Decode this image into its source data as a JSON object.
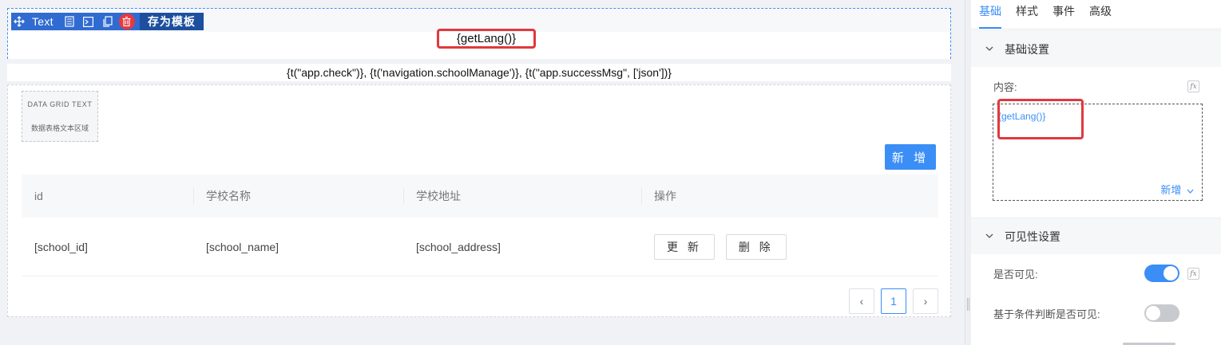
{
  "toolbar": {
    "component_label": "Text",
    "save_template_label": "存为模板",
    "icons": [
      "move-icon",
      "copy-icon",
      "code-icon",
      "duplicate-icon",
      "delete-icon"
    ]
  },
  "text_component": {
    "content": "{getLang()}"
  },
  "i18n_line": "{t(\"app.check\")},  {t('navigation.schoolManage')},  {t(\"app.successMsg\", ['json'])}",
  "data_grid": {
    "badge_title": "DATA GRID TEXT",
    "badge_subtitle": "数据表格文本区域",
    "add_label": "新 增",
    "columns": [
      "id",
      "学校名称",
      "学校地址",
      "操作"
    ],
    "row": {
      "id": "[school_id]",
      "name": "[school_name]",
      "address": "[school_address]",
      "update_label": "更 新",
      "delete_label": "删 除"
    },
    "pagination": {
      "prev": "‹",
      "current": "1",
      "next": "›"
    }
  },
  "panel": {
    "tabs": [
      "基础",
      "样式",
      "事件",
      "高级"
    ],
    "active_tab": "基础",
    "basic_section": {
      "title": "基础设置",
      "content_label": "内容:",
      "content_value": "{getLang()}",
      "add_label": "新增"
    },
    "visibility_section": {
      "title": "可见性设置",
      "visible_label": "是否可见:",
      "visible_on": true,
      "conditional_label": "基于条件判断是否可见:",
      "conditional_on": false
    },
    "fx_label": "fx"
  },
  "colors": {
    "accent": "#3a8ef6",
    "highlight": "#e0383e",
    "toolbar": "#2f6bd1"
  }
}
